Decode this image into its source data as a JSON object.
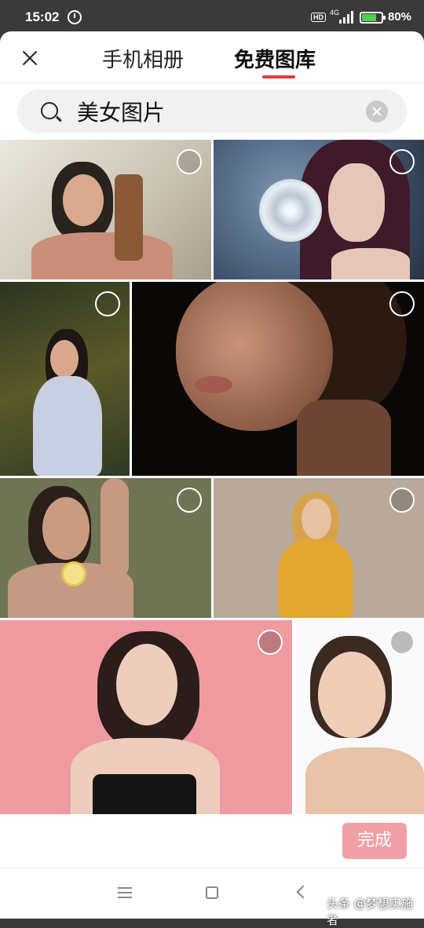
{
  "status_bar": {
    "time": "15:02",
    "hd": "HD",
    "network": "4G",
    "battery": "80%"
  },
  "header": {
    "tabs": [
      {
        "label": "手机相册",
        "active": false
      },
      {
        "label": "免费图库",
        "active": true
      }
    ],
    "accent": "#e23a45"
  },
  "search": {
    "value": "美女图片"
  },
  "footer": {
    "done_label": "完成",
    "done_color": "#f0a0a6"
  },
  "watermark": "头条 @梦想实施者"
}
